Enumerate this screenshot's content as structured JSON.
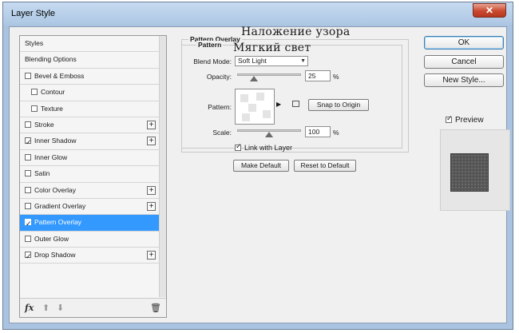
{
  "window": {
    "title": "Layer Style",
    "close_glyph": "✕"
  },
  "styles_list": {
    "items": [
      {
        "label": "Styles",
        "checkbox": false,
        "checked": false,
        "plus": false,
        "indent": false,
        "selected": false
      },
      {
        "label": "Blending Options",
        "checkbox": false,
        "checked": false,
        "plus": false,
        "indent": false,
        "selected": false
      },
      {
        "label": "Bevel & Emboss",
        "checkbox": true,
        "checked": false,
        "plus": false,
        "indent": false,
        "selected": false
      },
      {
        "label": "Contour",
        "checkbox": true,
        "checked": false,
        "plus": false,
        "indent": true,
        "selected": false
      },
      {
        "label": "Texture",
        "checkbox": true,
        "checked": false,
        "plus": false,
        "indent": true,
        "selected": false
      },
      {
        "label": "Stroke",
        "checkbox": true,
        "checked": false,
        "plus": true,
        "indent": false,
        "selected": false
      },
      {
        "label": "Inner Shadow",
        "checkbox": true,
        "checked": true,
        "plus": true,
        "indent": false,
        "selected": false
      },
      {
        "label": "Inner Glow",
        "checkbox": true,
        "checked": false,
        "plus": false,
        "indent": false,
        "selected": false
      },
      {
        "label": "Satin",
        "checkbox": true,
        "checked": false,
        "plus": false,
        "indent": false,
        "selected": false
      },
      {
        "label": "Color Overlay",
        "checkbox": true,
        "checked": false,
        "plus": true,
        "indent": false,
        "selected": false
      },
      {
        "label": "Gradient Overlay",
        "checkbox": true,
        "checked": false,
        "plus": true,
        "indent": false,
        "selected": false
      },
      {
        "label": "Pattern Overlay",
        "checkbox": true,
        "checked": true,
        "plus": false,
        "indent": false,
        "selected": true
      },
      {
        "label": "Outer Glow",
        "checkbox": true,
        "checked": false,
        "plus": false,
        "indent": false,
        "selected": false
      },
      {
        "label": "Drop Shadow",
        "checkbox": true,
        "checked": true,
        "plus": true,
        "indent": false,
        "selected": false
      }
    ],
    "footer": {
      "fx": "fx",
      "up": "⬆",
      "down": "⬇",
      "trash": "🗑"
    }
  },
  "pattern_overlay": {
    "group_title_1": "Pattern Overlay",
    "group_title_2": "Pattern",
    "blend_mode_label": "Blend Mode:",
    "blend_mode_value": "Soft Light",
    "opacity_label": "Opacity:",
    "opacity_value": "25",
    "opacity_unit": "%",
    "opacity_fraction": 0.25,
    "pattern_label": "Pattern:",
    "snap_button": "Snap to Origin",
    "scale_label": "Scale:",
    "scale_value": "100",
    "scale_unit": "%",
    "link_label": "Link with Layer",
    "link_checked": true,
    "make_default_button": "Make Default",
    "reset_default_button": "Reset to Default"
  },
  "annotations": {
    "line1": "Наложение узора",
    "line2": "Мягкий свет"
  },
  "actions": {
    "ok": "OK",
    "cancel": "Cancel",
    "new_style": "New Style...",
    "preview_label": "Preview",
    "preview_checked": true
  },
  "colors": {
    "selection": "#3399ff",
    "titlebar": "#adc7e4",
    "close": "#c9492f"
  }
}
